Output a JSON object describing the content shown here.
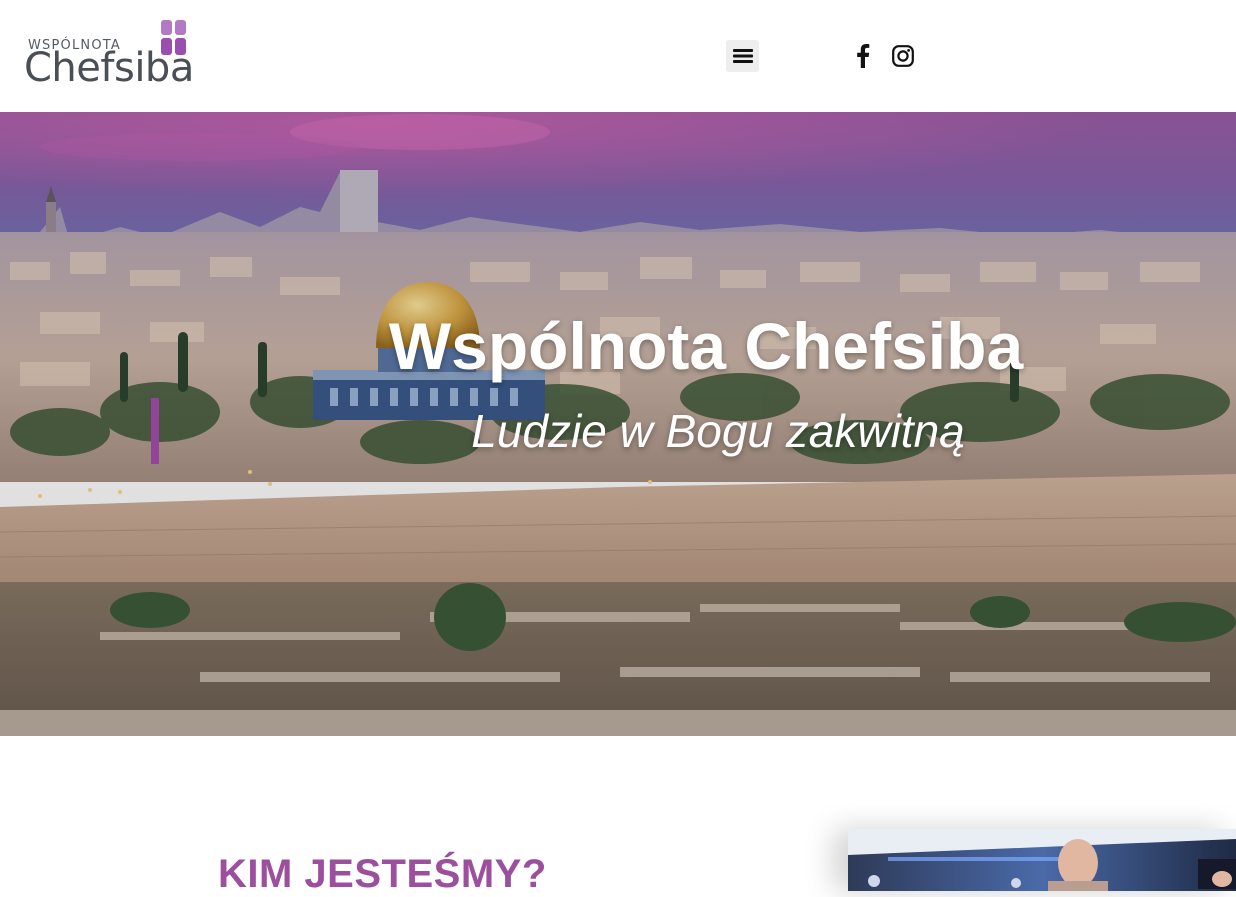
{
  "header": {
    "logo": {
      "small_text": "WSPÓLNOTA",
      "big_text": "Chefsiba",
      "mark_color": "#a05ab4"
    },
    "menu_icon": "hamburger-menu-icon",
    "social": [
      {
        "name": "facebook-icon"
      },
      {
        "name": "instagram-icon"
      }
    ]
  },
  "hero": {
    "title": "Wspólnota Chefsiba",
    "subtitle": "Ludzie w Bogu zakwitną"
  },
  "about": {
    "heading": "KIM JESTEŚMY?",
    "heading_color": "#9b4f9d"
  }
}
